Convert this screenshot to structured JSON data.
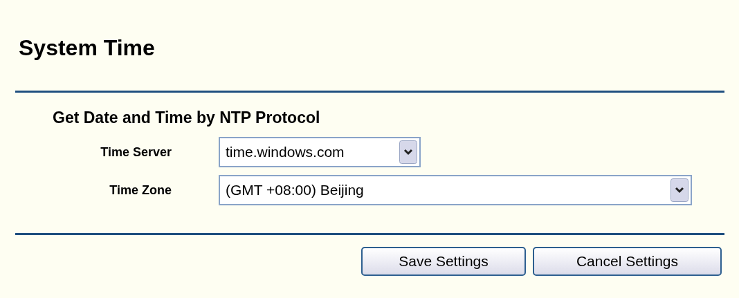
{
  "title": "System Time",
  "section": {
    "heading": "Get Date and Time by NTP Protocol",
    "fields": [
      {
        "label": "Time Server",
        "value": "time.windows.com",
        "kind": "short"
      },
      {
        "label": "Time Zone",
        "value": "(GMT +08:00) Beijing",
        "kind": "wide"
      }
    ]
  },
  "buttons": [
    "Save Settings",
    "Cancel Settings"
  ]
}
